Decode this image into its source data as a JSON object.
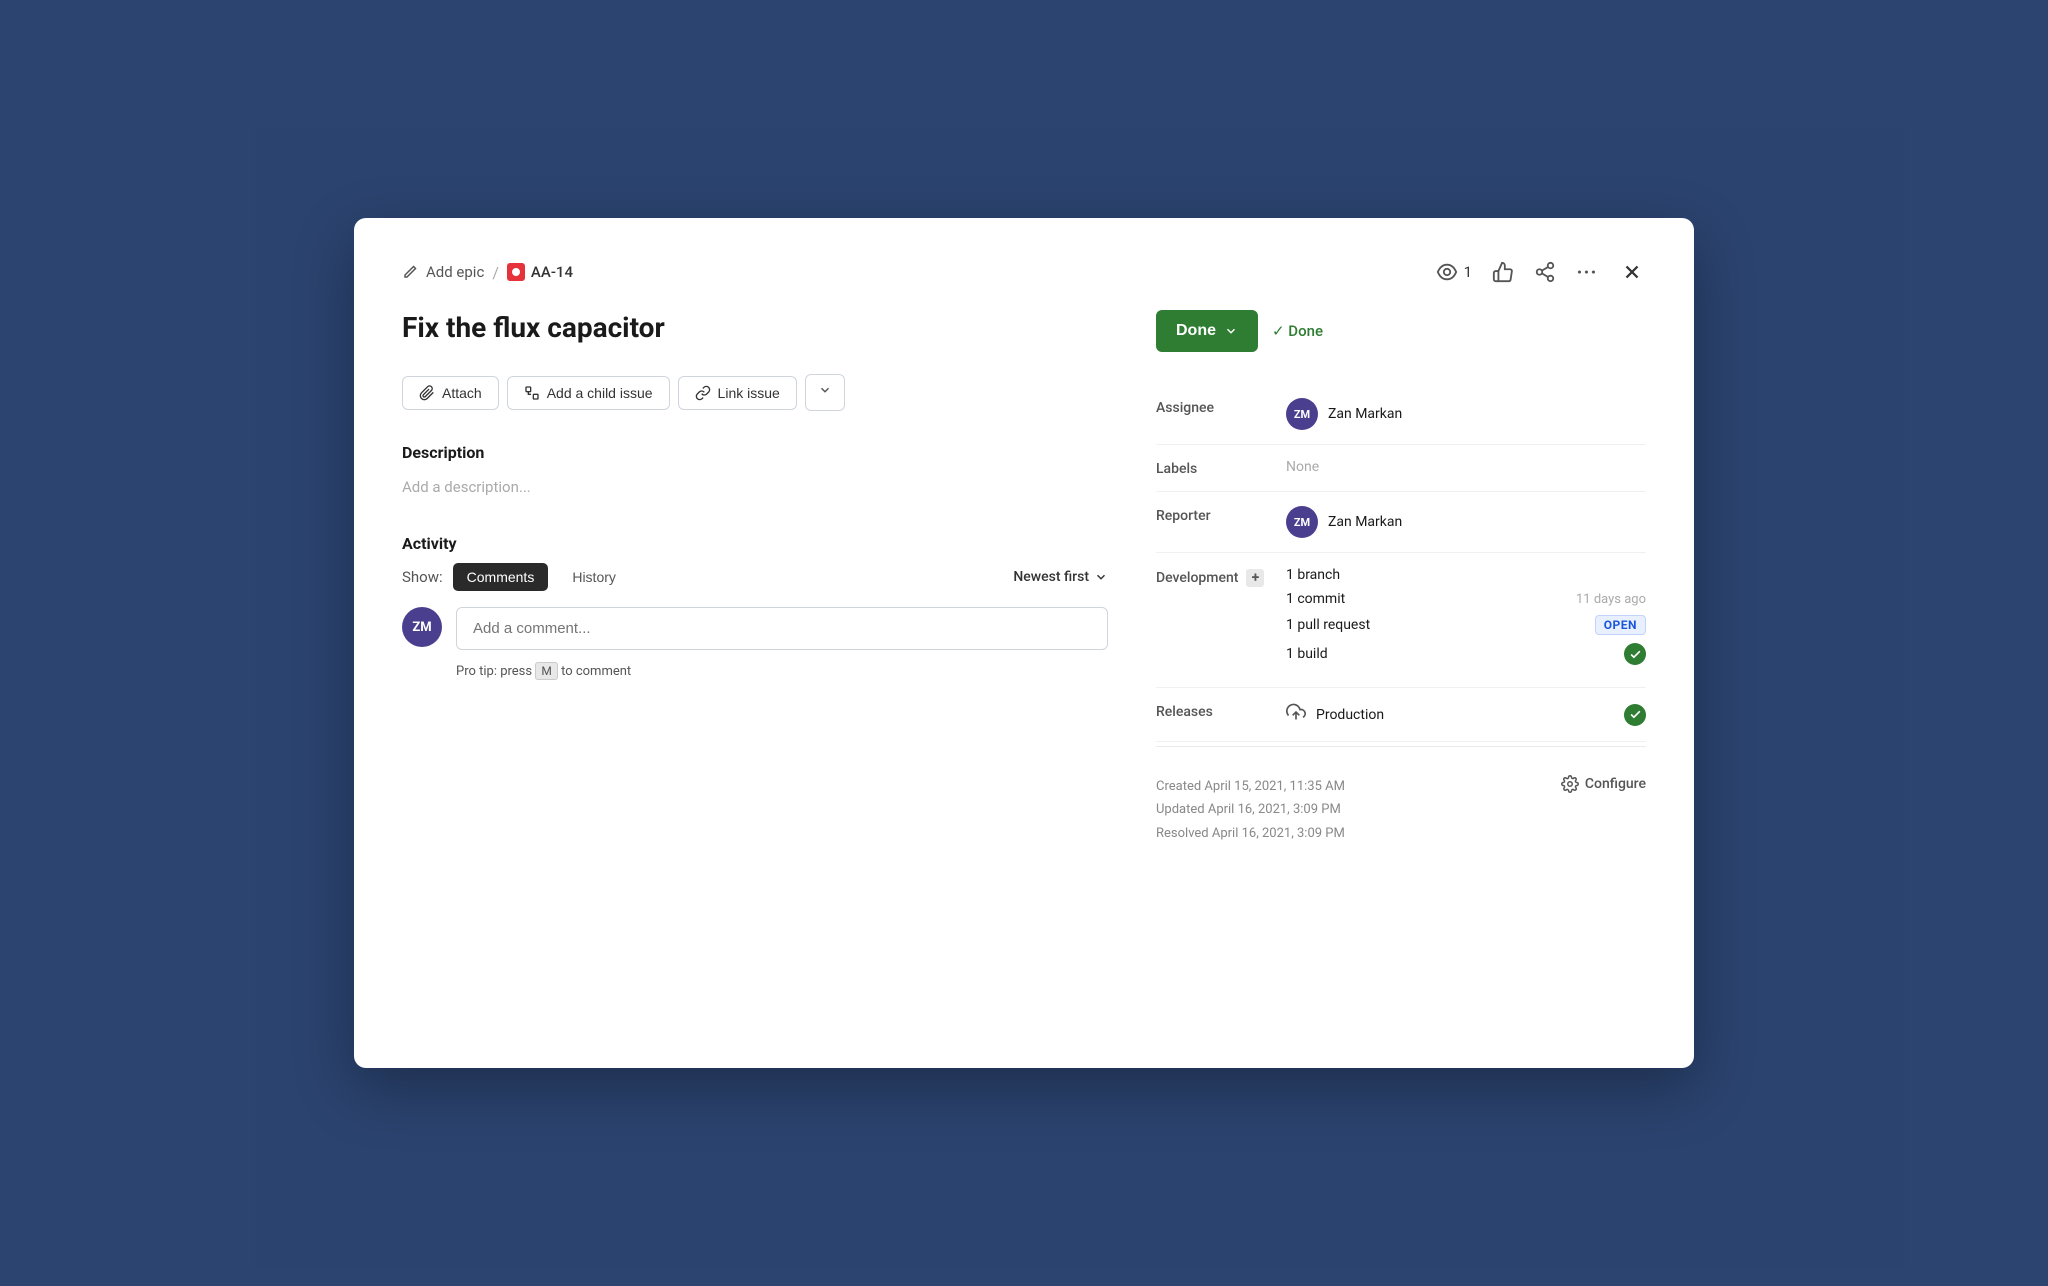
{
  "modal": {
    "breadcrumb": {
      "add_epic_label": "Add epic",
      "issue_id": "AA-14"
    },
    "header_actions": {
      "watch_count": "1",
      "watch_label": "1"
    },
    "title": "Fix the flux capacitor",
    "buttons": {
      "attach": "Attach",
      "add_child_issue": "Add a child issue",
      "link_issue": "Link issue",
      "more": "···"
    },
    "description": {
      "section_label": "Description",
      "placeholder": "Add a description..."
    },
    "activity": {
      "section_label": "Activity",
      "show_label": "Show:",
      "tab_comments": "Comments",
      "tab_history": "History",
      "sort_label": "Newest first",
      "comment_placeholder": "Add a comment...",
      "pro_tip_text": "Pro tip: press",
      "pro_tip_key": "M",
      "pro_tip_suffix": "to comment",
      "avatar_initials": "ZM"
    },
    "sidebar": {
      "status_button": "Done",
      "status_check": "✓ Done",
      "assignee_label": "Assignee",
      "assignee_name": "Zan Markan",
      "assignee_initials": "ZM",
      "labels_label": "Labels",
      "labels_value": "None",
      "reporter_label": "Reporter",
      "reporter_name": "Zan Markan",
      "reporter_initials": "ZM",
      "development_label": "Development",
      "dev_branch": "1 branch",
      "dev_commit": "1 commit",
      "dev_commit_meta": "11 days ago",
      "dev_pull_request": "1 pull request",
      "dev_pull_request_badge": "OPEN",
      "dev_build": "1 build",
      "releases_label": "Releases",
      "releases_name": "Production",
      "footer": {
        "created": "Created April 15, 2021, 11:35 AM",
        "updated": "Updated April 16, 2021, 3:09 PM",
        "resolved": "Resolved April 16, 2021, 3:09 PM",
        "configure": "Configure"
      }
    }
  }
}
